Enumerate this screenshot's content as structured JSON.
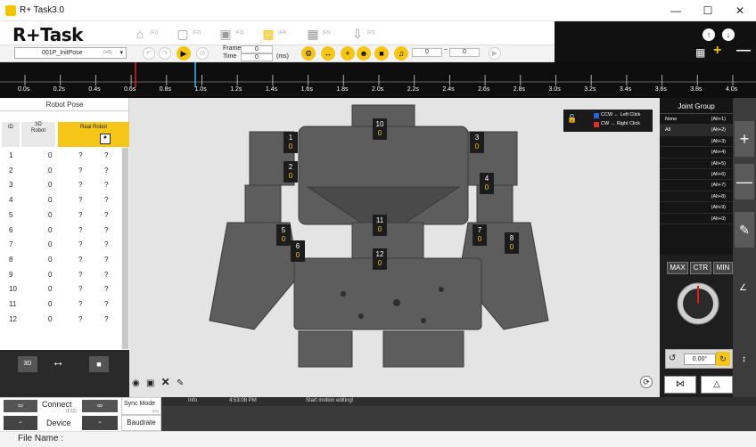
{
  "window": {
    "title": "R+ Task3.0"
  },
  "app": {
    "logo": "R+Task"
  },
  "toolbar": {
    "icons": [
      {
        "name": "home-icon",
        "sub": "(F1)"
      },
      {
        "name": "motion-icon",
        "sub": "(F2)"
      },
      {
        "name": "record-icon",
        "sub": "(F3)"
      },
      {
        "name": "film-icon",
        "sub": "(F4)"
      },
      {
        "name": "clapper-icon",
        "sub": "(F5)"
      },
      {
        "name": "download-icon",
        "sub": "(F6)"
      }
    ],
    "motion_select": {
      "value": "001P_InitPose",
      "hint": "(+0)"
    },
    "frame_label": "Frame",
    "time_label": "Time",
    "frame_value": "0",
    "time_value": "0",
    "time_unit": "(ms)",
    "page_field_a": "0",
    "page_field_b": "0"
  },
  "timeline": {
    "ticks": [
      "0.0s",
      "0.2s",
      "0.4s",
      "0.6s",
      "0.8s",
      "1.0s",
      "1.2s",
      "1.4s",
      "1.6s",
      "1.8s",
      "2.0s",
      "2.2s",
      "2.4s",
      "2.6s",
      "2.8s",
      "3.0s",
      "3.2s",
      "3.4s",
      "3.6s",
      "3.8s",
      "4.0s"
    ]
  },
  "robot_pose": {
    "title": "Robot Pose",
    "col_id": "ID",
    "col_3d": "3D Robot",
    "col_real": "Real Robot",
    "rows": [
      {
        "id": "1",
        "v3d": "0",
        "real": "?",
        "q": "?"
      },
      {
        "id": "2",
        "v3d": "0",
        "real": "?",
        "q": "?"
      },
      {
        "id": "3",
        "v3d": "0",
        "real": "?",
        "q": "?"
      },
      {
        "id": "4",
        "v3d": "0",
        "real": "?",
        "q": "?"
      },
      {
        "id": "5",
        "v3d": "0",
        "real": "?",
        "q": "?"
      },
      {
        "id": "6",
        "v3d": "0",
        "real": "?",
        "q": "?"
      },
      {
        "id": "7",
        "v3d": "0",
        "real": "?",
        "q": "?"
      },
      {
        "id": "8",
        "v3d": "0",
        "real": "?",
        "q": "?"
      },
      {
        "id": "9",
        "v3d": "0",
        "real": "?",
        "q": "?"
      },
      {
        "id": "10",
        "v3d": "0",
        "real": "?",
        "q": "?"
      },
      {
        "id": "11",
        "v3d": "0",
        "real": "?",
        "q": "?"
      },
      {
        "id": "12",
        "v3d": "0",
        "real": "?",
        "q": "?"
      }
    ]
  },
  "joints": [
    {
      "id": "1",
      "val": "0"
    },
    {
      "id": "2",
      "val": "0"
    },
    {
      "id": "3",
      "val": "0"
    },
    {
      "id": "4",
      "val": "0"
    },
    {
      "id": "5",
      "val": "0"
    },
    {
      "id": "6",
      "val": "0"
    },
    {
      "id": "7",
      "val": "0"
    },
    {
      "id": "8",
      "val": "0"
    },
    {
      "id": "10",
      "val": "0"
    },
    {
      "id": "11",
      "val": "0"
    },
    {
      "id": "12",
      "val": "0"
    }
  ],
  "legend": {
    "ccw": "CCW ← Left Click",
    "cw": "CW → Right Click"
  },
  "joint_group": {
    "title": "Joint Group",
    "rows": [
      {
        "label": "None",
        "key": "(Alt+1)"
      },
      {
        "label": "All",
        "key": "(Alt+2)"
      },
      {
        "label": "",
        "key": "(Alt+3)"
      },
      {
        "label": "",
        "key": "(Alt+4)"
      },
      {
        "label": "",
        "key": "(Alt+5)"
      },
      {
        "label": "",
        "key": "(Alt+6)"
      },
      {
        "label": "",
        "key": "(Alt+7)"
      },
      {
        "label": "",
        "key": "(Alt+8)"
      },
      {
        "label": "",
        "key": "(Alt+9)"
      },
      {
        "label": "",
        "key": "(Alt+0)"
      }
    ]
  },
  "control": {
    "max": "MAX",
    "ctr": "CTR",
    "min": "MIN",
    "angle": "0.00°"
  },
  "status": {
    "col1": "Info",
    "time": "4:53:08 PM",
    "msg": "Start motion editing!"
  },
  "bottom": {
    "connect": "Connect",
    "connect_key": "(F12)",
    "device": "Device",
    "sync": "Sync Mode",
    "sync_key": "(F5)",
    "baudrate": "Baudrate",
    "dash": "-",
    "file_name": "File Name :"
  },
  "colors": {
    "accent": "#f5c518",
    "dark": "#111111"
  }
}
